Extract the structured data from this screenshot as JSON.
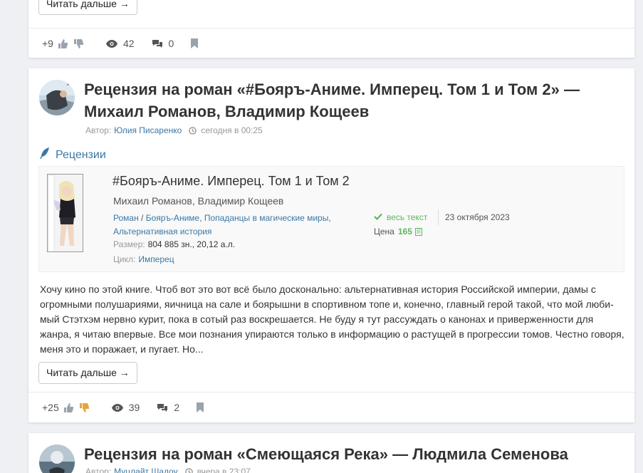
{
  "prev_post": {
    "read_more": "Читать дальше →",
    "rating": "+9",
    "views": "42",
    "comments": "0"
  },
  "post": {
    "title": "Рецензия на роман «#Бояръ-Аниме. Имперец. Том 1 и Том 2» — Михаил Романов, Владимир Кощеев",
    "author_label": "Автор:",
    "author": "Юлия Писаренко",
    "date": "сегодня в 00:25",
    "category": "Рецензии",
    "book": {
      "title": "#Бояръ-Аниме. Имперец. Том 1 и Том 2",
      "authors": "Михаил Романов, Владимир Кощеев",
      "genre_1": "Роман",
      "genre_sep": " / ",
      "genre_2": "Бояръ-Аниме",
      "genre_comma_1": ", ",
      "genre_3": "Попаданцы в магические миры",
      "genre_comma_2": ",",
      "genre_4": "Альтернативная история",
      "size_label": "Размер:",
      "size_value": "804 885 зн., 20,12 а.л.",
      "cycle_label": "Цикл:",
      "cycle": "Имперец",
      "status": "весь текст",
      "pub_date": "23 октября 2023",
      "price_label": "Цена",
      "price": "165",
      "currency_glyph": "20 80",
      "cover_text_top": "М. Романов, В. Кощеев",
      "cover_text_side": "ИМПЕРЕЦ"
    },
    "excerpt": "Хочу кино по этой книге. Чтоб вот это вот всё было досконально: альтернативная история Российской империи, дамы с огромными полушариями, яичница на сале и боярышни в спортивном топе и, конечно, главный герой такой, что мой люби­мый Стэтхэм нервно курит, пока в сотый раз воскрешается. Не буду я тут рассуждать о канонах и приверженности для жанра, я читаю впервые. Все мои познания упираются только в информацию о растущей в прогрессии томов. Честно гово­ря, меня это и поражает, и пугает. Но...",
    "read_more": "Читать дальше →",
    "rating": "+25",
    "views": "39",
    "comments": "2"
  },
  "next_post": {
    "title": "Рецензия на роман «Смеющаяся Река» — Людмила Семенова",
    "author_label": "Автор:",
    "author": "Муцлайт Шадоу",
    "date": "вчера в 23:07"
  },
  "colors": {
    "link": "#3b78a6",
    "accent_green": "#5cb85c",
    "dislike_active": "#e8a33d"
  }
}
